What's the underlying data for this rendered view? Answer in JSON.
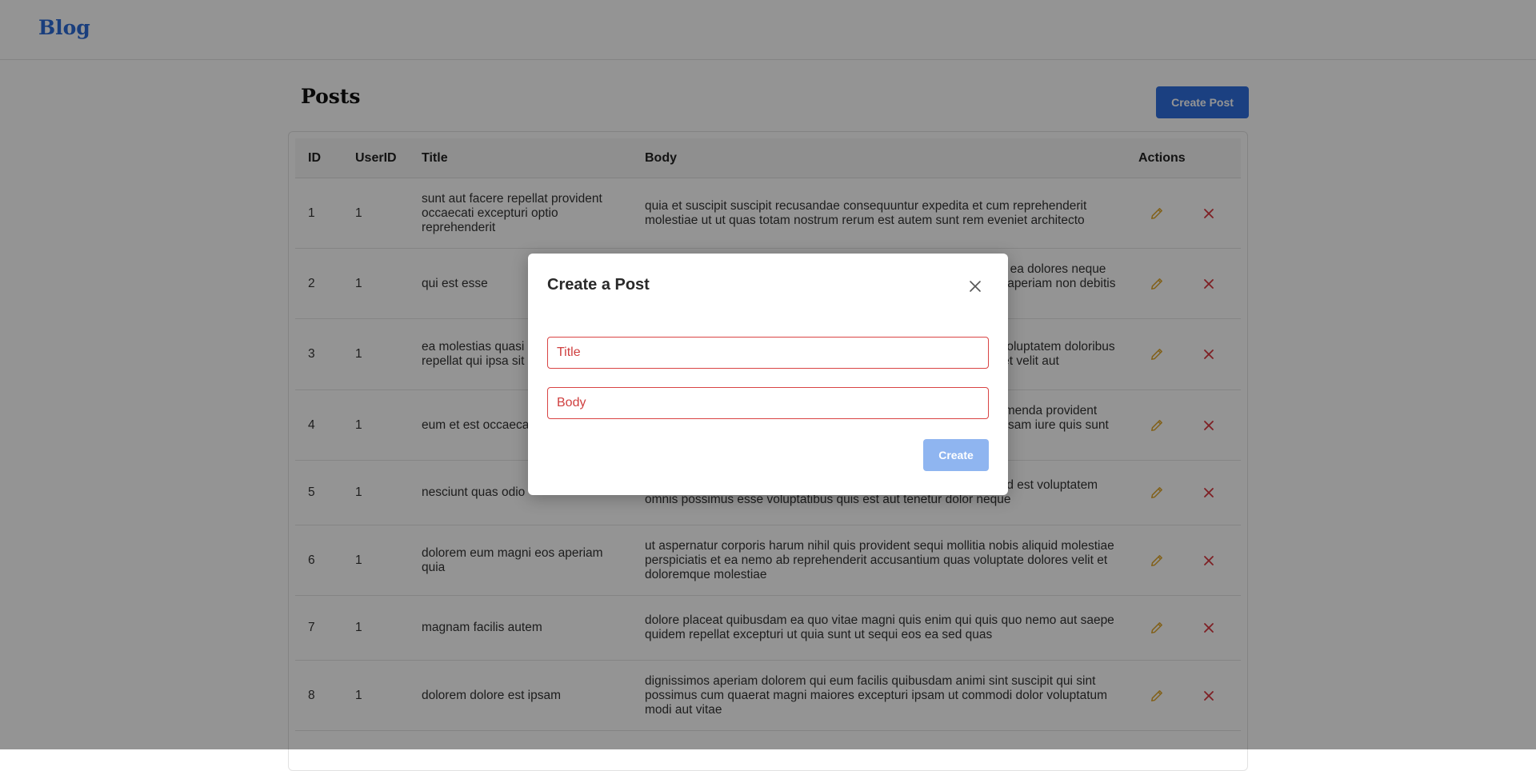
{
  "navbar": {
    "brand": "Blog"
  },
  "page": {
    "title": "Posts",
    "create_button_label": "Create Post"
  },
  "table": {
    "headers": {
      "id": "ID",
      "user_id": "UserID",
      "title": "Title",
      "body": "Body",
      "actions": "Actions"
    },
    "rows": [
      {
        "id": "1",
        "user_id": "1",
        "title": "sunt aut facere repellat provident occaecati excepturi optio reprehenderit",
        "body": "quia et suscipit suscipit recusandae consequuntur expedita et cum reprehenderit molestiae ut ut quas totam nostrum rerum est autem sunt rem eveniet architecto"
      },
      {
        "id": "2",
        "user_id": "1",
        "title": "qui est esse",
        "body": "est rerum tempore vitae sequi sint nihil reprehenderit dolor beatae ea dolores neque fugiat blanditiis voluptate porro vel nihil molestiae ut reiciendis qui aperiam non debitis possimus qui neque nisi nulla"
      },
      {
        "id": "3",
        "user_id": "1",
        "title": "ea molestias quasi exercitationem repellat qui ipsa sit aut",
        "body": "et iusto sed quo iure voluptatem occaecati omnis eligendi aut ad voluptatem doloribus vel accusantium quis pariatur molestiae porro eius odio et labore et velit aut"
      },
      {
        "id": "4",
        "user_id": "1",
        "title": "eum et est occaecati",
        "body": "ullam et saepe reiciendis voluptatem adipisci sit amet autem assumenda provident rerum culpa quis hic commodi nesciunt rem tenetur doloremque ipsam iure quis sunt voluptatem rerum illo velit"
      },
      {
        "id": "5",
        "user_id": "1",
        "title": "nesciunt quas odio",
        "body": "repudiandae veniam quaerat sunt sed alias aut fugiat sit autem sed est voluptatem omnis possimus esse voluptatibus quis est aut tenetur dolor neque"
      },
      {
        "id": "6",
        "user_id": "1",
        "title": "dolorem eum magni eos aperiam quia",
        "body": "ut aspernatur corporis harum nihil quis provident sequi mollitia nobis aliquid molestiae perspiciatis et ea nemo ab reprehenderit accusantium quas voluptate dolores velit et doloremque molestiae"
      },
      {
        "id": "7",
        "user_id": "1",
        "title": "magnam facilis autem",
        "body": "dolore placeat quibusdam ea quo vitae magni quis enim qui quis quo nemo aut saepe quidem repellat excepturi ut quia sunt ut sequi eos ea sed quas"
      },
      {
        "id": "8",
        "user_id": "1",
        "title": "dolorem dolore est ipsam",
        "body": "dignissimos aperiam dolorem qui eum facilis quibusdam animi sint suscipit qui sint possimus cum quaerat magni maiores excepturi ipsam ut commodi dolor voluptatum modi aut vitae"
      }
    ]
  },
  "icons": {
    "edit": "pencil-icon",
    "delete": "x-icon",
    "close": "close-icon"
  },
  "colors": {
    "brand": "#2b6bd8",
    "primary_button": "#2f6fde",
    "edit_icon": "#e0a72e",
    "delete_icon": "#d9363e",
    "invalid_field": "#d94444",
    "disabled_submit": "#8fb5f0"
  },
  "modal": {
    "title": "Create a Post",
    "title_placeholder": "Title",
    "body_placeholder": "Body",
    "submit_label": "Create"
  }
}
